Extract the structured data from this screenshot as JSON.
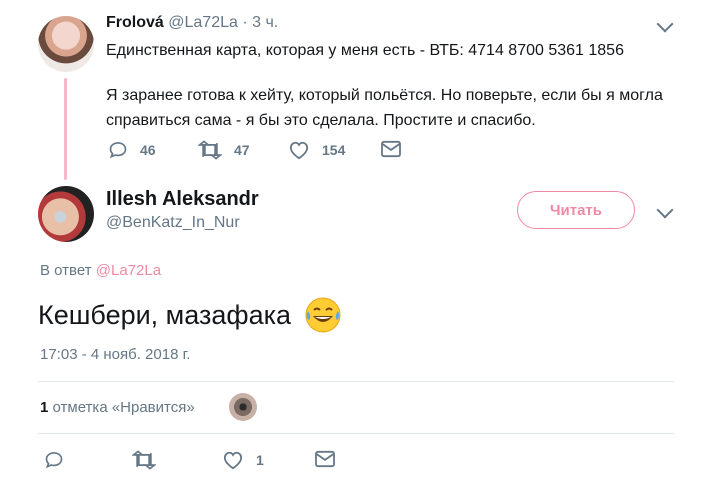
{
  "tweet1": {
    "author_name": "Frolová",
    "author_handle": "@La72La",
    "time": "3 ч.",
    "text_line1": "Единственная карта, которая у меня есть - ВТБ: 4714 8700 5361 1856",
    "text_line2": "Я заранее готова к хейту, который польётся. Но поверьте, если бы я могла справиться сама - я бы это сделала. Простите и спасибо.",
    "replies": "46",
    "retweets": "47",
    "likes": "154"
  },
  "tweet2": {
    "author_name": "Illesh Aleksandr",
    "author_handle": "@BenKatz_In_Nur",
    "follow_label": "Читать",
    "reply_prefix": "В ответ",
    "reply_mention": "@La72La",
    "text": "Кешбери, мазафака",
    "timestamp": "17:03 - 4 нояб. 2018 г.",
    "likes_count": "1",
    "likes_label": "отметка «Нравится»",
    "action_likes": "1"
  },
  "colors": {
    "accent_pink": "#f08aa4",
    "thread_line": "#f5b8c8",
    "muted_text": "#657786",
    "divider": "#e1e8ed"
  },
  "icons": [
    "chevron-down-icon",
    "reply-icon",
    "retweet-icon",
    "heart-icon",
    "message-icon",
    "face-with-tears-of-joy-emoji"
  ]
}
